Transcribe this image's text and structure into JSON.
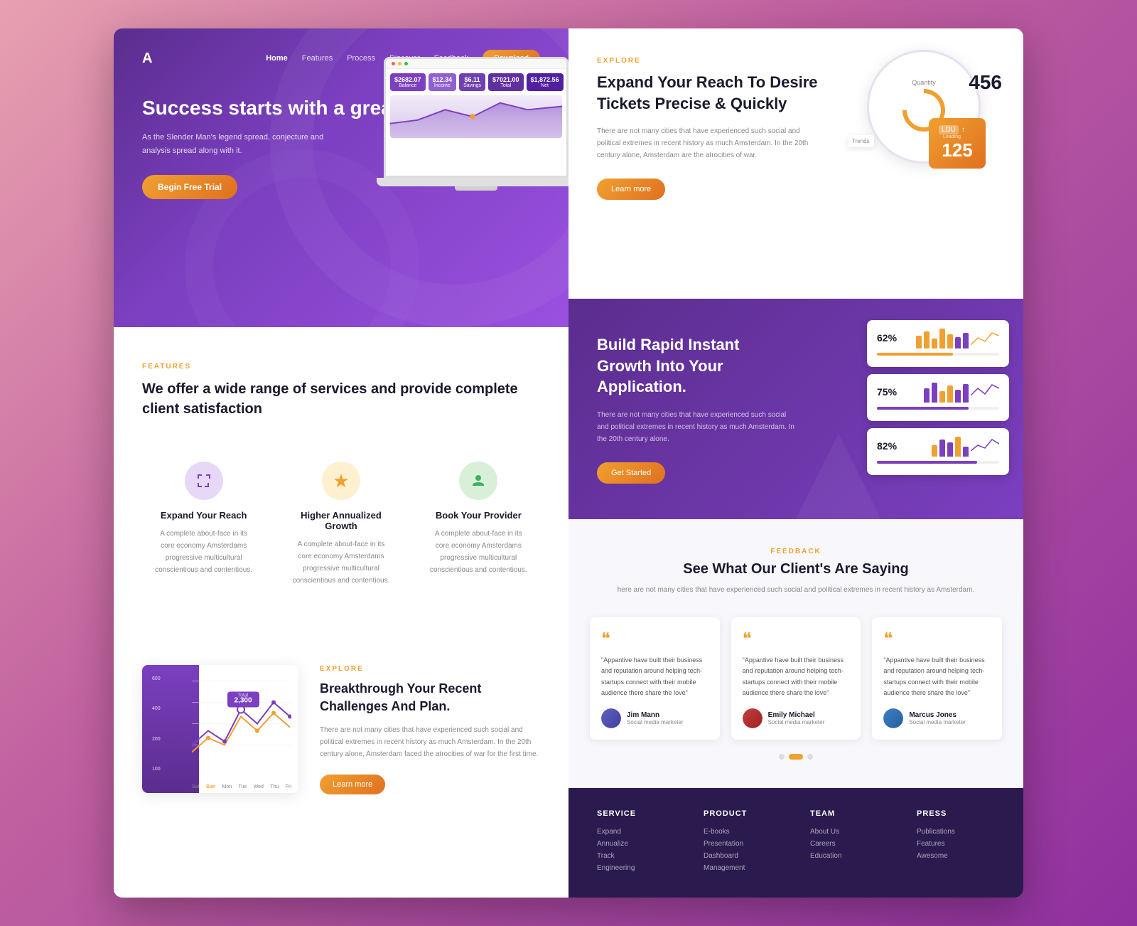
{
  "brand": {
    "logo": "A",
    "accent_color": "#f0a030",
    "purple_dark": "#5b2d8e",
    "purple_mid": "#7b3fc0"
  },
  "nav": {
    "links": [
      "Home",
      "Features",
      "Process",
      "Discover",
      "Feedback"
    ],
    "cta_label": "Download"
  },
  "hero": {
    "title": "Success starts with a great product.",
    "description": "As the Slender Man's legend spread, conjecture and analysis spread along with it.",
    "cta_label": "Begin Free Trial",
    "stats": [
      {
        "label": "Balance",
        "amount": "$2682.07"
      },
      {
        "label": "Income",
        "amount": "$12.34"
      },
      {
        "label": "Savings",
        "amount": "$6.11"
      },
      {
        "label": "Total",
        "amount": "$7021.00"
      },
      {
        "label": "Net",
        "amount": "$1,872.56"
      }
    ]
  },
  "features": {
    "label": "FEATURES",
    "title": "We offer a wide range of services and provide complete client satisfaction",
    "items": [
      {
        "title": "Expand Your Reach",
        "icon": "⤢",
        "icon_color": "purple",
        "description": "A complete about-face in its core economy Amsterdams progressive multicultural conscientious and contentious."
      },
      {
        "title": "Higher Annualized Growth",
        "icon": "⚡",
        "icon_color": "yellow",
        "description": "A complete about-face in its core economy Amsterdams progressive multicultural conscientious and contentious."
      },
      {
        "title": "Book Your Provider",
        "icon": "🎤",
        "icon_color": "green",
        "description": "A complete about-face in its core economy Amsterdams progressive multicultural conscientious and contentious."
      }
    ]
  },
  "explore_bottom": {
    "label": "EXPLORE",
    "title": "Breakthrough Your Recent Challenges And Plan.",
    "description": "There are not many cities that have experienced such social and political extremes in recent history as much Amsterdam. In the 20th century alone, Amsterdam faced the atrocities of war for the first time.",
    "cta_label": "Learn more",
    "chart": {
      "y_labels": [
        "600",
        "400",
        "200",
        "100"
      ],
      "x_labels": [
        "Sat",
        "Sun",
        "Mon",
        "Tue",
        "Wed",
        "Thu",
        "Fri"
      ],
      "tooltip_value": "2,300",
      "tooltip_label": "Total"
    }
  },
  "right_explore": {
    "label": "EXPLORE",
    "title": "Expand Your Reach To Desire Tickets Precise & Quickly",
    "description": "There are not many cities that have experienced such social and political extremes in recent history as much Amsterdam. In the 20th century alone, Amsterdam are the atrocities of war.",
    "cta_label": "Learn more",
    "widget": {
      "quantity_label": "Quantity",
      "quantity_value": "456",
      "trends_label": "Trends",
      "ldu_label": "LDU",
      "ldu_sub": "Leading",
      "ldu_value": "125"
    }
  },
  "growth": {
    "title": "Build Rapid Instant Growth Into Your Application.",
    "description": "There are not many cities that have experienced such social and political extremes in recent history as much Amsterdam. In the 20th century alone.",
    "cta_label": "Get Started",
    "progress_cards": [
      {
        "percent": "62%",
        "fill_width": 62,
        "color": "#f0a030"
      },
      {
        "percent": "75%",
        "fill_width": 75,
        "color": "#7b3fc0"
      },
      {
        "percent": "82%",
        "fill_width": 82,
        "color": "#7b3fc0"
      }
    ]
  },
  "feedback": {
    "label": "FEEDBACK",
    "title": "See What Our Client's Are Saying",
    "description": "here are not many cities that have experienced such social and political extremes in recent history as Amsterdam.",
    "testimonials": [
      {
        "text": "\"Appantive have built their business and reputation around helping tech-startups connect with their mobile audience there share the love\"",
        "author_name": "Jim Mann",
        "author_role": "Social media marketer",
        "avatar_color": "#6060c0"
      },
      {
        "text": "\"Appantive have built their business and reputation around helping tech-startups connect with their mobile audience there share the love\"",
        "author_name": "Emily Michael",
        "author_role": "Social media marketer",
        "avatar_color": "#c04040"
      },
      {
        "text": "\"Appantive have built their business and reputation around helping tech-startups connect with their mobile audience there share the love\"",
        "author_name": "Marcus Jones",
        "author_role": "Social media marketer",
        "avatar_color": "#4080c0"
      }
    ]
  },
  "footer": {
    "columns": [
      {
        "title": "SERVICE",
        "links": [
          "Expand",
          "Annualize",
          "Track",
          "Engineering"
        ]
      },
      {
        "title": "PRODUCT",
        "links": [
          "E-books",
          "Presentation",
          "Dashboard",
          "Management"
        ]
      },
      {
        "title": "TEAM",
        "links": [
          "About Us",
          "Careers",
          "Education"
        ]
      },
      {
        "title": "PRESS",
        "links": [
          "Publications",
          "Features",
          "Awesome"
        ]
      }
    ]
  }
}
